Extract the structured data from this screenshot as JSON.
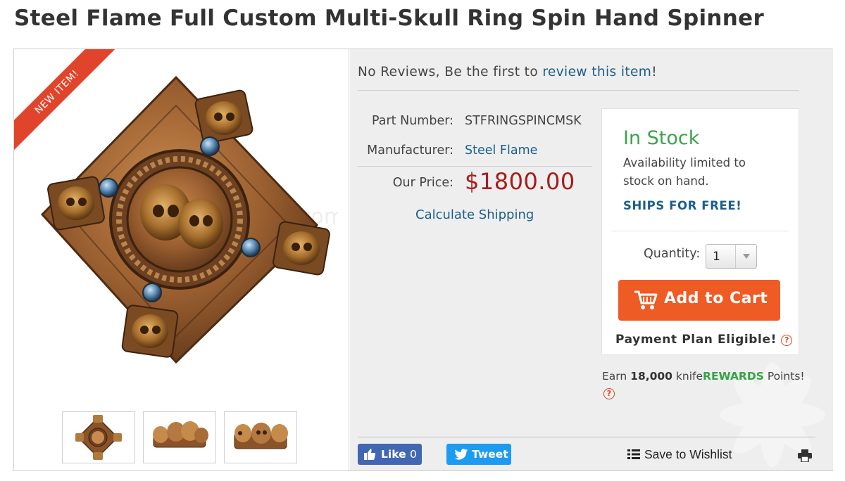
{
  "product": {
    "title": "Steel Flame Full Custom Multi-Skull Ring Spin Hand Spinner"
  },
  "gallery": {
    "ribbon_label": "NEW ITEM!",
    "watermark_text": "com",
    "thumbnails": [
      "thumb-front",
      "thumb-side",
      "thumb-angle"
    ]
  },
  "reviews": {
    "prefix": "No Reviews, Be the first to ",
    "link": "review this item",
    "suffix": "!"
  },
  "specs": {
    "part_number_label": "Part Number:",
    "part_number_value": "STFRINGSPINCMSK",
    "manufacturer_label": "Manufacturer:",
    "manufacturer_value": "Steel Flame",
    "price_label": "Our Price:",
    "price_value": "$1800.00",
    "calc_shipping": "Calculate Shipping"
  },
  "stock": {
    "status": "In Stock",
    "availability": "Availability limited to stock on hand.",
    "ships": "SHIPS FOR FREE!",
    "quantity_label": "Quantity:",
    "quantity_value": "1",
    "add_to_cart": "Add to Cart",
    "payment_plan": "Payment Plan Eligible!",
    "help_glyph": "?"
  },
  "rewards": {
    "prefix": "Earn ",
    "points": "18,000",
    "brand_pre": " knife",
    "brand": "REWARDS",
    "suffix": " Points!"
  },
  "social": {
    "like_label": "Like",
    "like_count": "0",
    "tweet_label": "Tweet",
    "wishlist_label": "Save to Wishlist"
  },
  "colors": {
    "price": "#a81c1c",
    "in_stock": "#3aa34a",
    "link": "#1b5e8a",
    "cart_button": "#ef5b25",
    "ribbon": "#e0442a",
    "facebook": "#4267b2",
    "twitter": "#1d9bf0",
    "rewards": "#33a345"
  },
  "icons": [
    "cart-icon",
    "thumbs-up-icon",
    "twitter-bird-icon",
    "list-icon",
    "print-icon",
    "help-icon",
    "dropdown-arrow-icon"
  ]
}
